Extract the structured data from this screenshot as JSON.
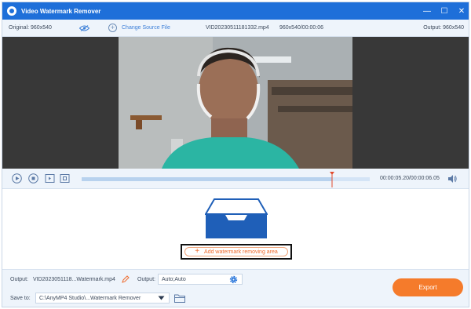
{
  "window": {
    "title": "Video Watermark Remover",
    "controls": {
      "minimize": "—",
      "maximize": "☐",
      "close": "✕"
    }
  },
  "infobar": {
    "original": "Original: 960x540",
    "change_source": "Change Source File",
    "file_name": "VID20230511181332.mp4",
    "resolution_time": "960x540/00:00:06",
    "output": "Output: 960x540"
  },
  "playback": {
    "timecode": "00:00:05.20/00:00:06.05",
    "progress": 0.87
  },
  "editor": {
    "add_area_label": "Add watermark removing area"
  },
  "bottom": {
    "output_label": "Output:",
    "output_name": "VID2023051118...Watermark.mp4",
    "format_label": "Output:",
    "format_value": "Auto;Auto",
    "save_label": "Save to:",
    "save_path": "C:\\AnyMP4 Studio\\...Watermark Remover",
    "export_label": "Export"
  },
  "colors": {
    "titlebar": "#1e6fd9",
    "accent_orange": "#f57b2b",
    "panel_bg": "#eef4fb"
  },
  "icons": [
    "app-logo-icon",
    "eye-icon",
    "plus-circle-icon",
    "play-icon",
    "stop-icon",
    "prev-frame-icon",
    "next-frame-icon",
    "volume-icon",
    "tray-icon",
    "edit-icon",
    "gear-icon",
    "chevron-down-icon",
    "folder-icon"
  ]
}
